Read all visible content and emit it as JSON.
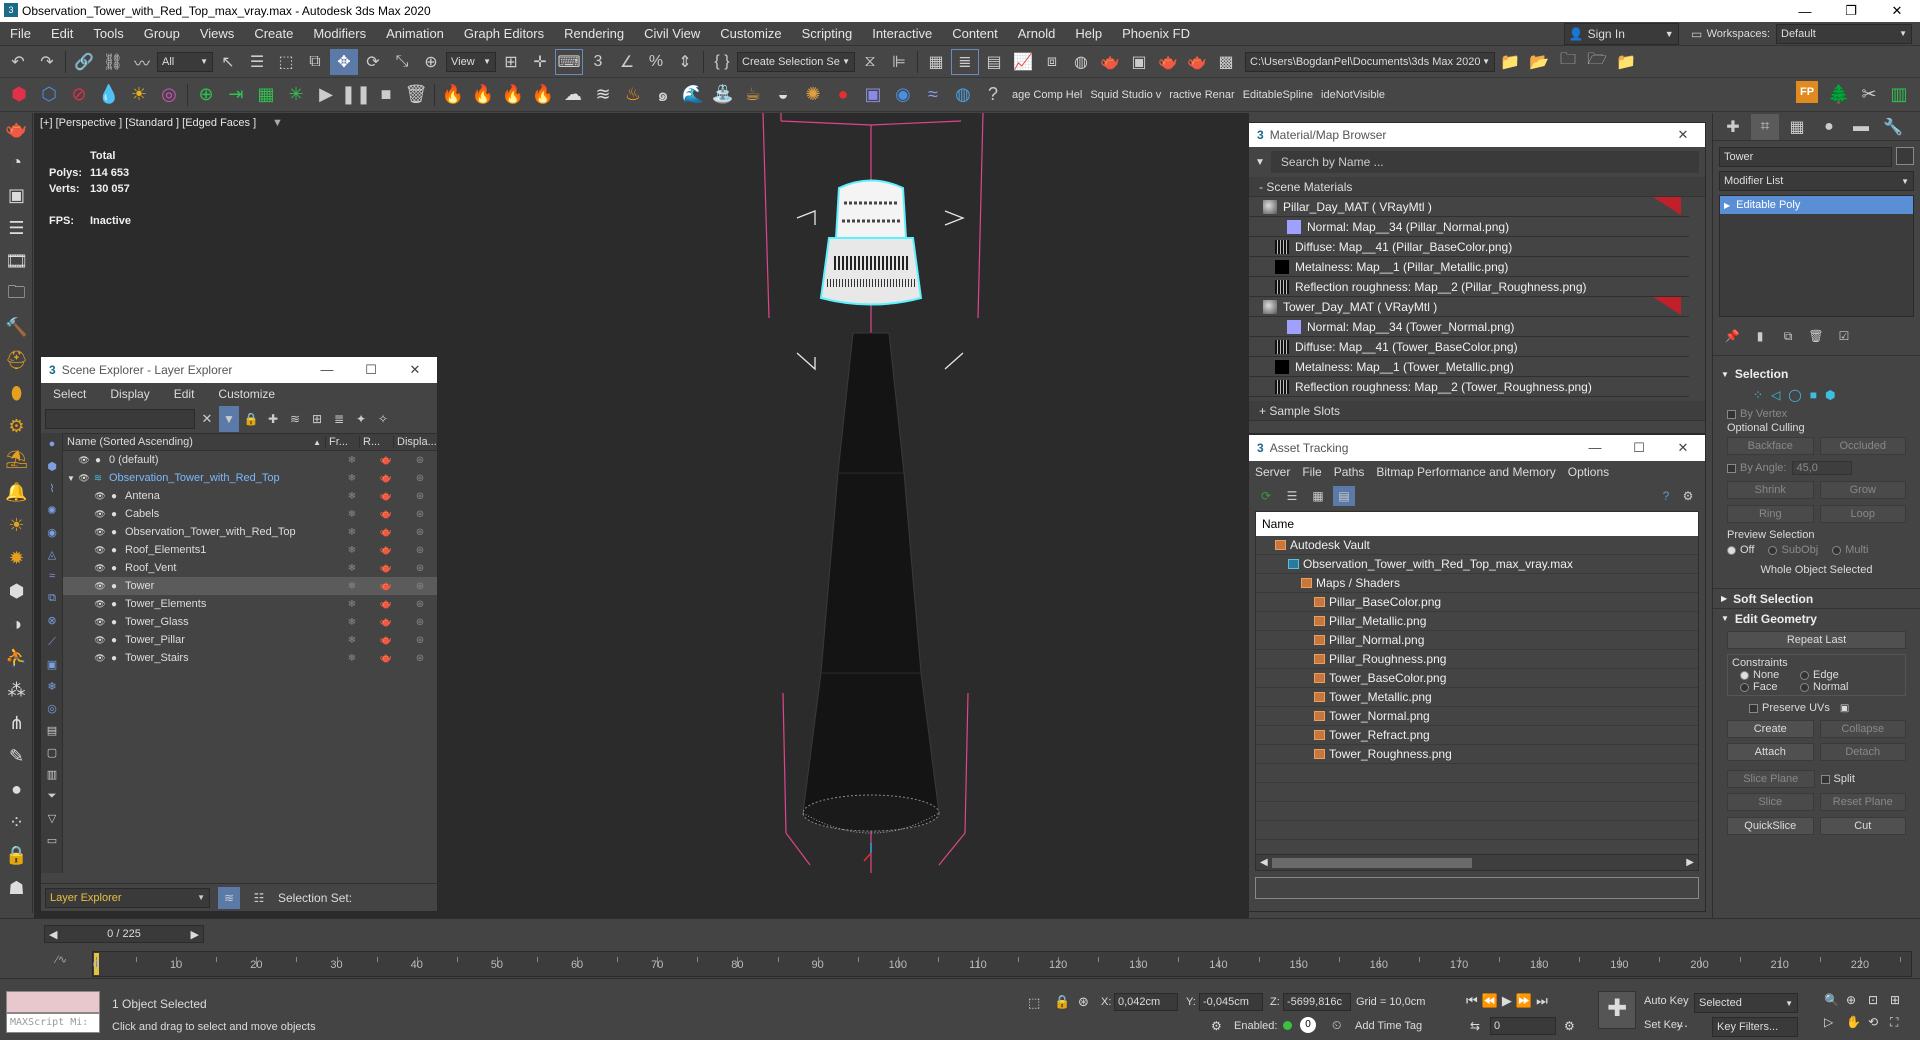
{
  "window": {
    "title": "Observation_Tower_with_Red_Top_max_vray.max - Autodesk 3ds Max 2020",
    "min": "—",
    "max": "❐",
    "close": "✕"
  },
  "menu": [
    "File",
    "Edit",
    "Tools",
    "Group",
    "Views",
    "Create",
    "Modifiers",
    "Animation",
    "Graph Editors",
    "Rendering",
    "Civil View",
    "Customize",
    "Scripting",
    "Interactive",
    "Content",
    "Arnold",
    "Help",
    "Phoenix FD"
  ],
  "signin": "Sign In",
  "workspaces_label": "Workspaces:",
  "workspace": "Default",
  "toolbar1": {
    "filter": "All",
    "refcoord": "View",
    "selset": "Create Selection Se",
    "path": "C:\\Users\\BogdanPel\\Documents\\3ds Max 2020"
  },
  "toolbar2": {
    "labels": [
      "age Comp Hel",
      "Squid Studio v",
      "ractive Renar",
      "EditableSpline",
      "ideNotVisible"
    ]
  },
  "viewport": {
    "label": "[+] [Perspective ] [Standard ] [Edged Faces ]",
    "total": "Total",
    "polys_label": "Polys:",
    "polys": "114 653",
    "verts_label": "Verts:",
    "verts": "130 057",
    "fps_label": "FPS:",
    "fps": "Inactive"
  },
  "scene_explorer": {
    "title": "Scene Explorer - Layer Explorer",
    "menu": [
      "Select",
      "Display",
      "Edit",
      "Customize"
    ],
    "cols": [
      "Name (Sorted Ascending)",
      "Fr...",
      "R...",
      "Displa..."
    ],
    "rows": [
      {
        "name": "0 (default)",
        "indent": 0,
        "sel": false
      },
      {
        "name": "Observation_Tower_with_Red_Top",
        "indent": 0,
        "sel": false,
        "layer": true
      },
      {
        "name": "Antena",
        "indent": 1,
        "sel": false
      },
      {
        "name": "Cabels",
        "indent": 1,
        "sel": false
      },
      {
        "name": "Observation_Tower_with_Red_Top",
        "indent": 1,
        "sel": false
      },
      {
        "name": "Roof_Elements1",
        "indent": 1,
        "sel": false
      },
      {
        "name": "Roof_Vent",
        "indent": 1,
        "sel": false
      },
      {
        "name": "Tower",
        "indent": 1,
        "sel": true
      },
      {
        "name": "Tower_Elements",
        "indent": 1,
        "sel": false
      },
      {
        "name": "Tower_Glass",
        "indent": 1,
        "sel": false
      },
      {
        "name": "Tower_Pillar",
        "indent": 1,
        "sel": false
      },
      {
        "name": "Tower_Stairs",
        "indent": 1,
        "sel": false
      }
    ],
    "footer_explorer": "Layer Explorer",
    "footer_selset": "Selection Set:"
  },
  "material_browser": {
    "title": "Material/Map Browser",
    "search": "Search by Name ...",
    "section": "- Scene Materials",
    "sample": "+ Sample Slots",
    "rows": [
      {
        "t": "Pillar_Day_MAT ( VRayMtl )",
        "lvl": 0,
        "red": true,
        "th": "mat"
      },
      {
        "t": "Normal: Map__34 (Pillar_Normal.png)",
        "lvl": 2,
        "th": "normal"
      },
      {
        "t": "Diffuse: Map__41 (Pillar_BaseColor.png)",
        "lvl": 1,
        "th": "tex"
      },
      {
        "t": "Metalness: Map__1 (Pillar_Metallic.png)",
        "lvl": 1,
        "th": "black"
      },
      {
        "t": "Reflection roughness: Map__2 (Pillar_Roughness.png)",
        "lvl": 1,
        "th": "tex"
      },
      {
        "t": "Tower_Day_MAT ( VRayMtl )",
        "lvl": 0,
        "red": true,
        "th": "mat"
      },
      {
        "t": "Normal: Map__34 (Tower_Normal.png)",
        "lvl": 2,
        "th": "normal"
      },
      {
        "t": "Diffuse: Map__41 (Tower_BaseColor.png)",
        "lvl": 1,
        "th": "tex"
      },
      {
        "t": "Metalness: Map__1 (Tower_Metallic.png)",
        "lvl": 1,
        "th": "black"
      },
      {
        "t": "Reflection roughness: Map__2 (Tower_Roughness.png)",
        "lvl": 1,
        "th": "tex"
      }
    ]
  },
  "asset_tracking": {
    "title": "Asset Tracking",
    "menu": [
      "Server",
      "File",
      "Paths",
      "Bitmap Performance and Memory",
      "Options"
    ],
    "col": "Name",
    "rows": [
      {
        "t": "Autodesk Vault",
        "lvl": 1
      },
      {
        "t": "Observation_Tower_with_Red_Top_max_vray.max",
        "lvl": 2,
        "max": true
      },
      {
        "t": "Maps / Shaders",
        "lvl": 3
      },
      {
        "t": "Pillar_BaseColor.png",
        "lvl": 4
      },
      {
        "t": "Pillar_Metallic.png",
        "lvl": 4
      },
      {
        "t": "Pillar_Normal.png",
        "lvl": 4
      },
      {
        "t": "Pillar_Roughness.png",
        "lvl": 4
      },
      {
        "t": "Tower_BaseColor.png",
        "lvl": 4
      },
      {
        "t": "Tower_Metallic.png",
        "lvl": 4
      },
      {
        "t": "Tower_Normal.png",
        "lvl": 4
      },
      {
        "t": "Tower_Refract.png",
        "lvl": 4
      },
      {
        "t": "Tower_Roughness.png",
        "lvl": 4
      }
    ]
  },
  "command_panel": {
    "object_name": "Tower",
    "modifier_list": "Modifier List",
    "stack_item": "Editable Poly",
    "selection": "Selection",
    "by_vertex": "By Vertex",
    "optional_culling": "Optional Culling",
    "backface": "Backface",
    "occluded": "Occluded",
    "by_angle": "By Angle:",
    "angle": "45,0",
    "shrink": "Shrink",
    "grow": "Grow",
    "ring": "Ring",
    "loop": "Loop",
    "preview_selection": "Preview Selection",
    "off": "Off",
    "subobj": "SubObj",
    "multi": "Multi",
    "whole": "Whole Object Selected",
    "soft_selection": "Soft Selection",
    "edit_geometry": "Edit Geometry",
    "repeat_last": "Repeat Last",
    "constraints": "Constraints",
    "none": "None",
    "edge": "Edge",
    "face": "Face",
    "normal": "Normal",
    "preserve_uvs": "Preserve UVs",
    "create": "Create",
    "collapse": "Collapse",
    "attach": "Attach",
    "detach": "Detach",
    "slice_plane": "Slice Plane",
    "split": "Split",
    "slice": "Slice",
    "reset_plane": "Reset Plane",
    "quickslice": "QuickSlice",
    "cut": "Cut"
  },
  "timeline": {
    "frame": "0 / 225",
    "ticks": [
      0,
      10,
      20,
      30,
      40,
      50,
      60,
      70,
      80,
      90,
      100,
      110,
      120,
      130,
      140,
      150,
      160,
      170,
      180,
      190,
      200,
      210,
      220
    ]
  },
  "status": {
    "maxscript": "MAXScript Mi:",
    "selected": "1 Object Selected",
    "hint": "Click and drag to select and move objects",
    "x_label": "X:",
    "x": "0,042cm",
    "y_label": "Y:",
    "y": "-0,045cm",
    "z_label": "Z:",
    "z": "-5699,816c",
    "grid": "Grid = 10,0cm",
    "enabled": "Enabled:",
    "add_time_tag": "Add Time Tag",
    "auto_key": "Auto Key",
    "set_key": "Set Key",
    "selected_dd": "Selected",
    "key_filters": "Key Filters...",
    "frame_field": "0"
  },
  "colors": {
    "accent": "#5b9bd5",
    "selection_bbox": "#e6e6e6",
    "pink": "#e0458a",
    "cyan": "#5ff0ff",
    "red": "#c0202a"
  }
}
